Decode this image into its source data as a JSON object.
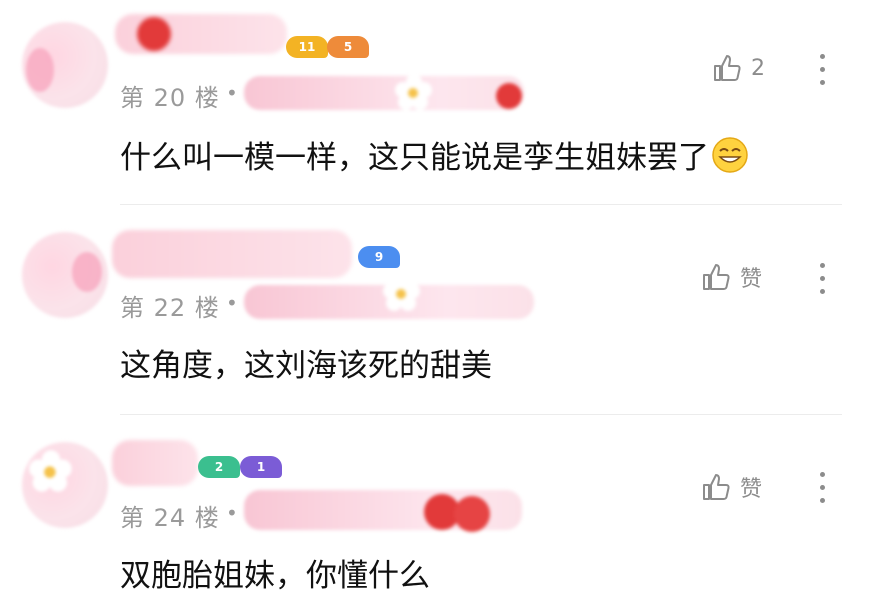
{
  "comments": [
    {
      "floor": "第 20 楼",
      "separator": "•",
      "text": "什么叫一模一样，这只能说是孪生姐妹罢了",
      "emoji": "grinning-emoji",
      "like_label": "2",
      "badges": [
        {
          "label": "11",
          "color": "#f3b324"
        },
        {
          "label": "5",
          "color": "#ee8b3a"
        }
      ]
    },
    {
      "floor": "第 22 楼",
      "separator": "•",
      "text": "这角度，这刘海该死的甜美",
      "like_label": "赞",
      "badges": [
        {
          "label": "9",
          "color": "#4c8ef0"
        }
      ]
    },
    {
      "floor": "第 24 楼",
      "separator": "•",
      "text": "双胞胎姐妹，你懂什么",
      "like_label": "赞",
      "badges": [
        {
          "label": "2",
          "color": "#3bbf8f"
        },
        {
          "label": "1",
          "color": "#7b5cd6"
        }
      ]
    }
  ]
}
